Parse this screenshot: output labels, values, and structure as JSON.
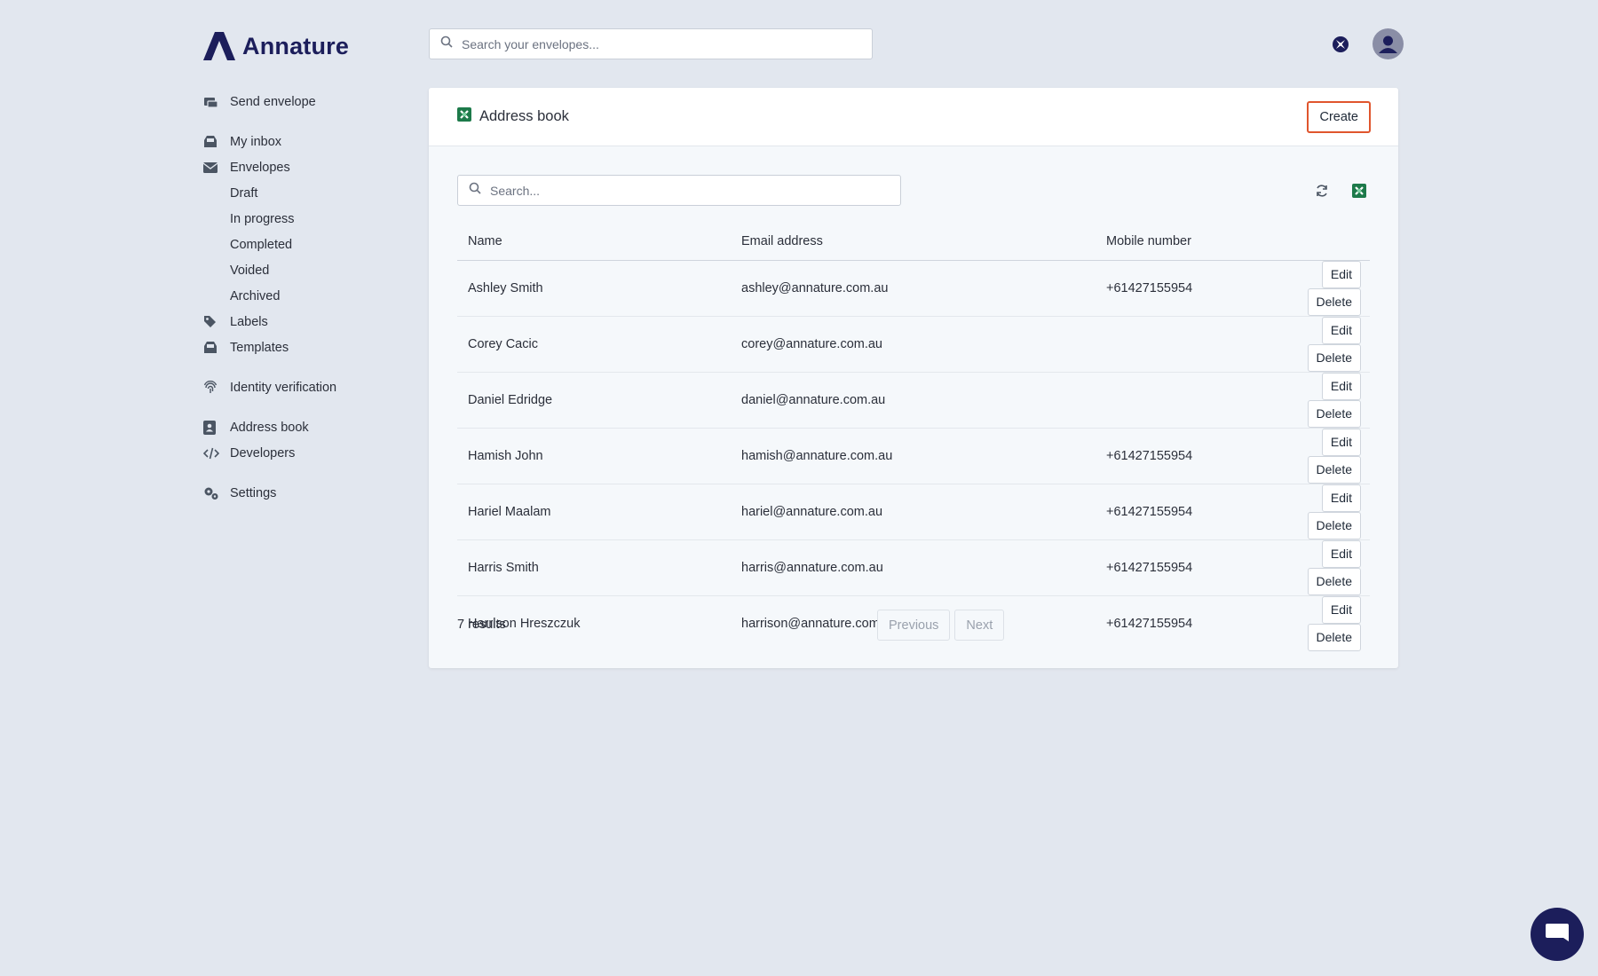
{
  "brand": {
    "name": "Annature"
  },
  "top_search": {
    "placeholder": "Search your envelopes..."
  },
  "sidebar": {
    "items": [
      {
        "label": "Send envelope",
        "icon": "send-envelope-icon"
      },
      {
        "label": "My inbox",
        "icon": "inbox-icon"
      },
      {
        "label": "Envelopes",
        "icon": "envelope-icon"
      },
      {
        "label": "Draft"
      },
      {
        "label": "In progress"
      },
      {
        "label": "Completed"
      },
      {
        "label": "Voided"
      },
      {
        "label": "Archived"
      },
      {
        "label": "Labels",
        "icon": "tag-icon"
      },
      {
        "label": "Templates",
        "icon": "templates-icon"
      },
      {
        "label": "Identity verification",
        "icon": "fingerprint-icon"
      },
      {
        "label": "Address book",
        "icon": "address-book-icon"
      },
      {
        "label": "Developers",
        "icon": "code-icon"
      },
      {
        "label": "Settings",
        "icon": "gears-icon"
      }
    ]
  },
  "card": {
    "title": "Address book",
    "create_label": "Create",
    "search_placeholder": "Search...",
    "columns": [
      "Name",
      "Email address",
      "Mobile number"
    ],
    "rows": [
      {
        "name": "Ashley Smith",
        "email": "ashley@annature.com.au",
        "mobile": "+61427155954"
      },
      {
        "name": "Corey Cacic",
        "email": "corey@annature.com.au",
        "mobile": ""
      },
      {
        "name": "Daniel Edridge",
        "email": "daniel@annature.com.au",
        "mobile": ""
      },
      {
        "name": "Hamish John",
        "email": "hamish@annature.com.au",
        "mobile": "+61427155954"
      },
      {
        "name": "Hariel Maalam",
        "email": "hariel@annature.com.au",
        "mobile": "+61427155954"
      },
      {
        "name": "Harris Smith",
        "email": "harris@annature.com.au",
        "mobile": "+61427155954"
      },
      {
        "name": "Harrison Hreszczuk",
        "email": "harrison@annature.com.au",
        "mobile": "+61427155954"
      }
    ],
    "edit_label": "Edit",
    "delete_label": "Delete",
    "results_text": "7 results",
    "previous_label": "Previous",
    "next_label": "Next"
  },
  "colors": {
    "accent": "#e0552d",
    "brand": "#1c1e5b",
    "excel_green": "#1d7a4a",
    "background": "#e2e7ef"
  }
}
